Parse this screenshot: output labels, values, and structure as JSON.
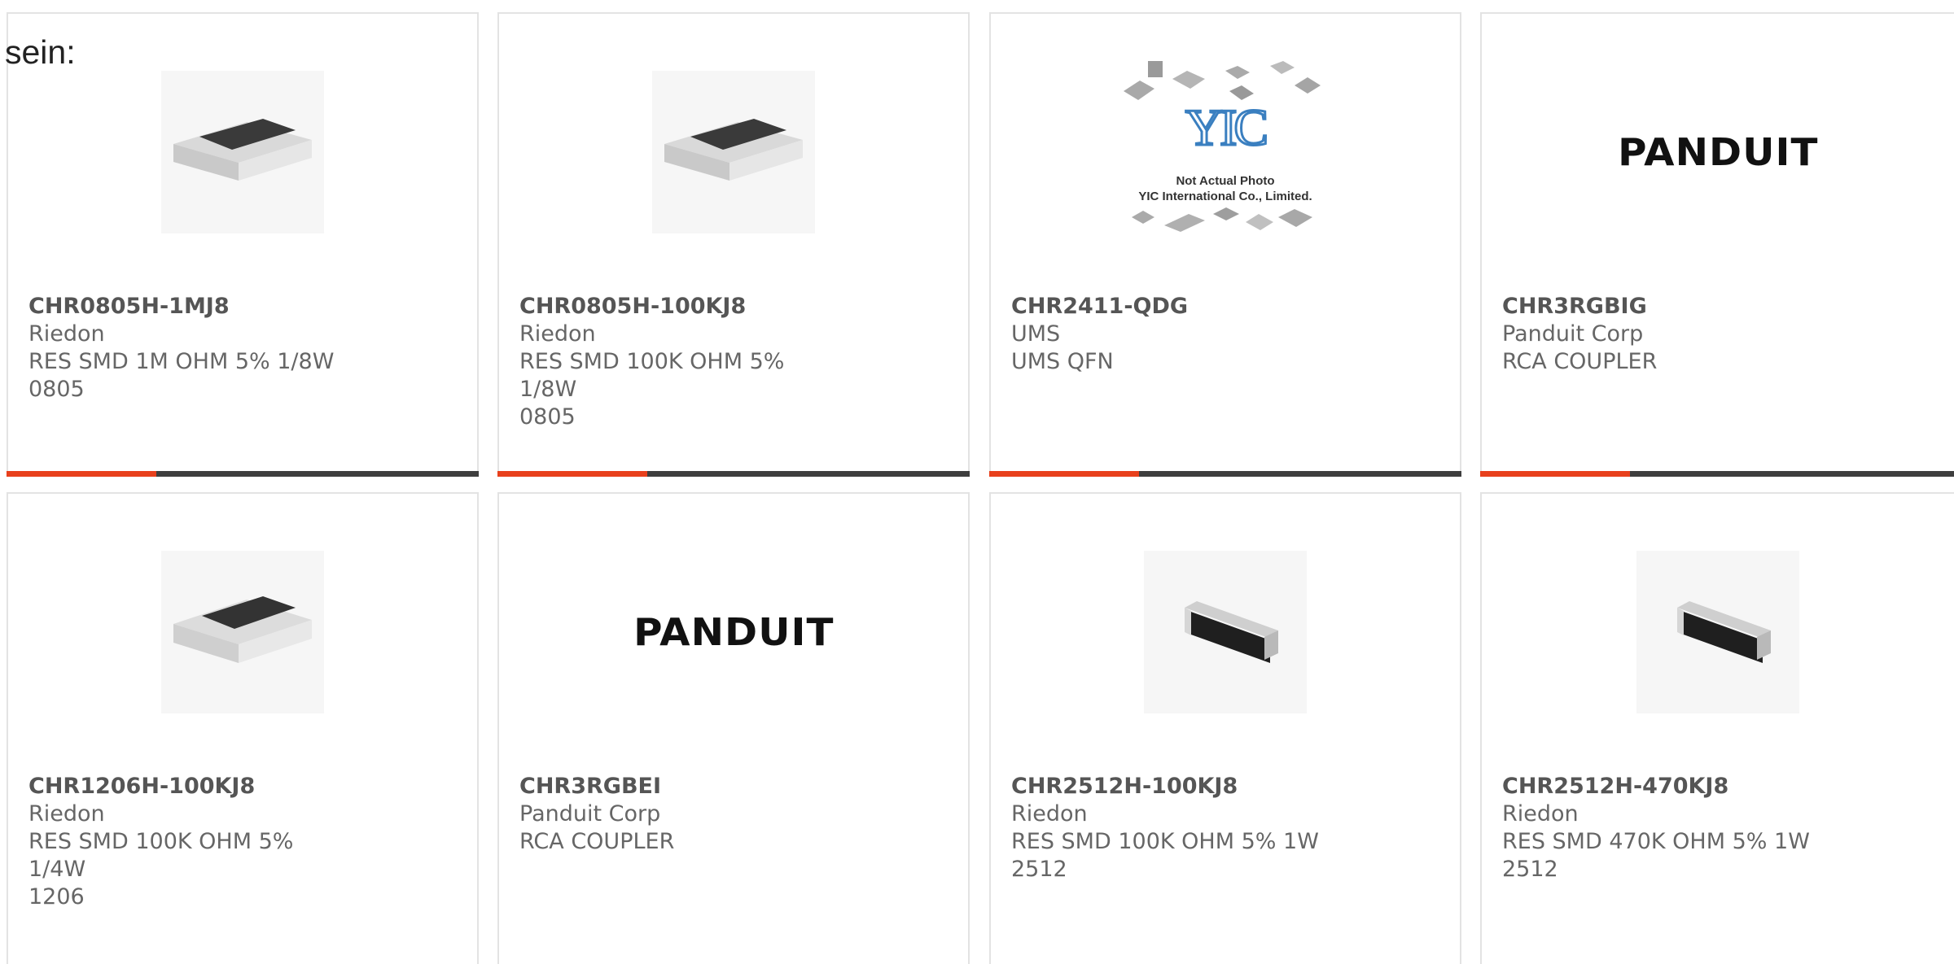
{
  "page": {
    "prefix": "sein:"
  },
  "products": [
    {
      "pn": "CHR0805H-1MJ8",
      "mfr": "Riedon",
      "desc": "RES SMD 1M OHM 5% 1/8W",
      "pkg": "0805",
      "image": "chip-resistor-image"
    },
    {
      "pn": "CHR0805H-100KJ8",
      "mfr": "Riedon",
      "desc": "RES SMD 100K OHM 5% 1/8W",
      "pkg": "0805",
      "image": "chip-resistor-image"
    },
    {
      "pn": "CHR2411-QDG",
      "mfr": "UMS",
      "desc": "UMS QFN",
      "pkg": "",
      "image": "yic-placeholder-image",
      "placeholder": {
        "logo": "YIC",
        "line1": "Not Actual Photo",
        "line2": "YIC International Co., Limited."
      }
    },
    {
      "pn": "CHR3RGBIG",
      "mfr": "Panduit Corp",
      "desc": "RCA COUPLER",
      "pkg": "",
      "image": "panduit-logo",
      "logo_text": "PANDUIT"
    },
    {
      "pn": "CHR1206H-100KJ8",
      "mfr": "Riedon",
      "desc": "RES SMD 100K OHM 5% 1/4W",
      "pkg": "1206",
      "image": "chip-resistor-image"
    },
    {
      "pn": "CHR3RGBEI",
      "mfr": "Panduit Corp",
      "desc": "RCA COUPLER",
      "pkg": "",
      "image": "panduit-logo",
      "logo_text": "PANDUIT"
    },
    {
      "pn": "CHR2512H-100KJ8",
      "mfr": "Riedon",
      "desc": "RES SMD 100K OHM 5% 1W",
      "pkg": "2512",
      "image": "long-resistor-image"
    },
    {
      "pn": "CHR2512H-470KJ8",
      "mfr": "Riedon",
      "desc": "RES SMD 470K OHM 5% 1W",
      "pkg": "2512",
      "image": "long-resistor-image"
    }
  ],
  "colors": {
    "accent": "#e8401c",
    "bar": "#3e3e3e",
    "border": "#e3e3e3",
    "text": "#666666"
  }
}
